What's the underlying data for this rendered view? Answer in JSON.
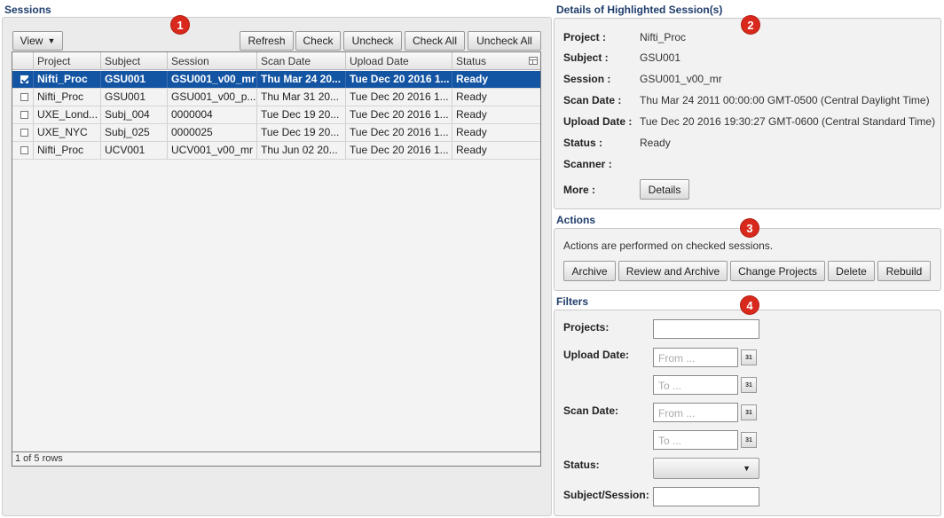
{
  "sessions": {
    "title": "Sessions",
    "view_label": "View",
    "toolbar": [
      "Refresh",
      "Check",
      "Uncheck",
      "Check All",
      "Uncheck All"
    ],
    "columns": [
      "Project",
      "Subject",
      "Session",
      "Scan Date",
      "Upload Date",
      "Status"
    ],
    "rows": [
      {
        "checked": true,
        "selected": true,
        "cells": [
          "Nifti_Proc",
          "GSU001",
          "GSU001_v00_mr",
          "Thu Mar 24 20...",
          "Tue Dec 20 2016 1...",
          "Ready"
        ]
      },
      {
        "checked": false,
        "selected": false,
        "cells": [
          "Nifti_Proc",
          "GSU001",
          "GSU001_v00_p...",
          "Thu Mar 31 20...",
          "Tue Dec 20 2016 1...",
          "Ready"
        ]
      },
      {
        "checked": false,
        "selected": false,
        "cells": [
          "UXE_Lond...",
          "Subj_004",
          "0000004",
          "Tue Dec 19 20...",
          "Tue Dec 20 2016 1...",
          "Ready"
        ]
      },
      {
        "checked": false,
        "selected": false,
        "cells": [
          "UXE_NYC",
          "Subj_025",
          "0000025",
          "Tue Dec 19 20...",
          "Tue Dec 20 2016 1...",
          "Ready"
        ]
      },
      {
        "checked": false,
        "selected": false,
        "cells": [
          "Nifti_Proc",
          "UCV001",
          "UCV001_v00_mr",
          "Thu Jun 02 20...",
          "Tue Dec 20 2016 1...",
          "Ready"
        ]
      }
    ],
    "footer": "1 of 5 rows"
  },
  "details": {
    "title": "Details of Highlighted Session(s)",
    "project_label": "Project :",
    "project": "Nifti_Proc",
    "subject_label": "Subject :",
    "subject": "GSU001",
    "session_label": "Session :",
    "session": "GSU001_v00_mr",
    "scan_label": "Scan Date :",
    "scan": "Thu Mar 24 2011 00:00:00 GMT-0500 (Central Daylight Time)",
    "upload_label": "Upload Date :",
    "upload": "Tue Dec 20 2016 19:30:27 GMT-0600 (Central Standard Time)",
    "status_label": "Status :",
    "status": "Ready",
    "scanner_label": "Scanner :",
    "more_label": "More :",
    "details_button": "Details"
  },
  "actions": {
    "title": "Actions",
    "note": "Actions are performed on checked sessions.",
    "buttons": [
      "Archive",
      "Review and Archive",
      "Change Projects",
      "Delete",
      "Rebuild"
    ]
  },
  "filters": {
    "title": "Filters",
    "projects_label": "Projects:",
    "upload_label": "Upload Date:",
    "scan_label": "Scan Date:",
    "status_label": "Status:",
    "subject_label": "Subject/Session:",
    "from_placeholder": "From ...",
    "to_placeholder": "To ...",
    "calendar_glyph": "31"
  },
  "badges": [
    "1",
    "2",
    "3",
    "4"
  ],
  "colors": {
    "badge": "#d9291c",
    "selection": "#1455a3",
    "section_title": "#1f3d6b"
  }
}
